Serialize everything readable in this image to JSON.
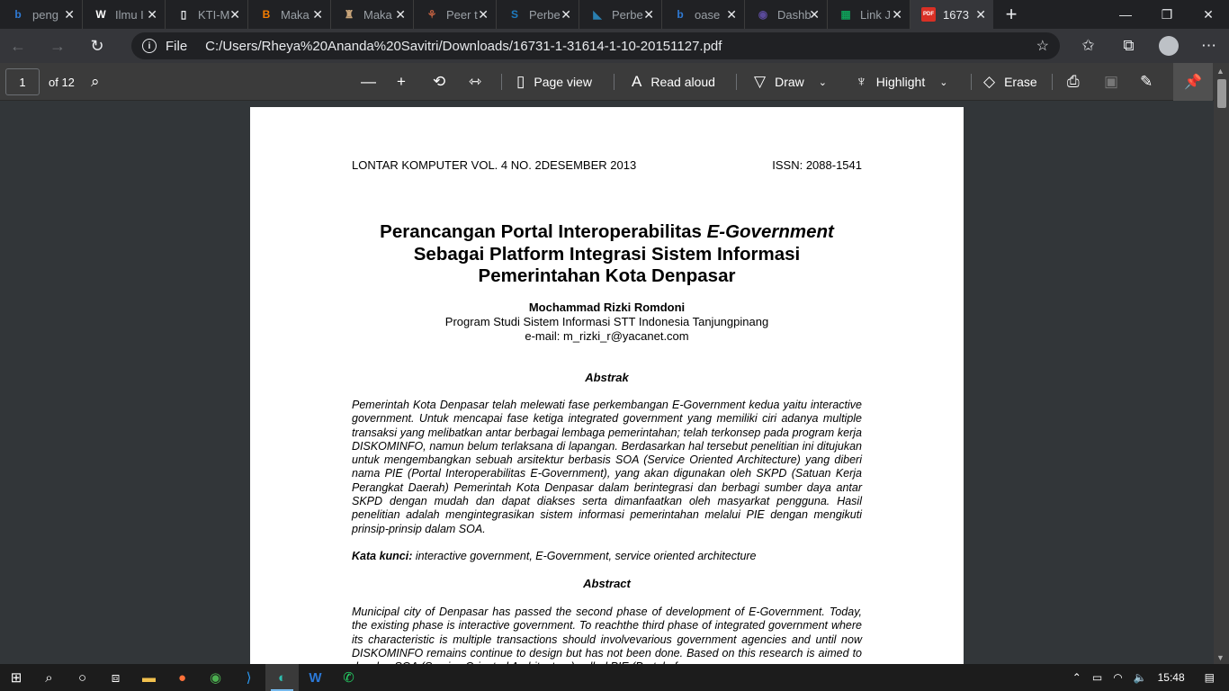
{
  "browser": {
    "tabs": [
      {
        "label": "peng",
        "icon": "bing-icon",
        "color": "#2f7bd6",
        "glyph": "b"
      },
      {
        "label": "Ilmu I",
        "icon": "wordpress-icon",
        "color": "#ffffff",
        "glyph": "W"
      },
      {
        "label": "KTI-M",
        "icon": "document-icon",
        "color": "#e8eaed",
        "glyph": "▯"
      },
      {
        "label": "Maka",
        "icon": "blogger-icon",
        "color": "#f57d00",
        "glyph": "B"
      },
      {
        "label": "Maka",
        "icon": "site-icon",
        "color": "#c9a57a",
        "glyph": "♜"
      },
      {
        "label": "Peer t",
        "icon": "site-icon",
        "color": "#c06040",
        "glyph": "⚘"
      },
      {
        "label": "Perbe",
        "icon": "scribd-icon",
        "color": "#1e7bc0",
        "glyph": "S"
      },
      {
        "label": "Perbe",
        "icon": "site-icon",
        "color": "#2a7fb0",
        "glyph": "◣"
      },
      {
        "label": "oase",
        "icon": "bing-icon",
        "color": "#2f7bd6",
        "glyph": "b"
      },
      {
        "label": "Dashb",
        "icon": "site-icon",
        "color": "#5a4a9a",
        "glyph": "◉"
      },
      {
        "label": "Link J",
        "icon": "sheets-icon",
        "color": "#0f9d58",
        "glyph": "▦"
      },
      {
        "label": "1673",
        "icon": "pdf-icon",
        "color": "#d93025",
        "glyph": "PDF"
      }
    ],
    "window_controls": {
      "minimize": "—",
      "restore": "❐",
      "close": "✕"
    },
    "address": {
      "scheme_label": "File",
      "url": "C:/Users/Rheya%20Ananda%20Savitri/Downloads/16731-1-31614-1-10-20151127.pdf"
    }
  },
  "pdf_toolbar": {
    "page_number": "1",
    "page_count": "of 12",
    "page_view": "Page view",
    "read_aloud": "Read aloud",
    "draw": "Draw",
    "highlight": "Highlight",
    "erase": "Erase"
  },
  "document": {
    "journal": "LONTAR KOMPUTER VOL. 4 NO. 2DESEMBER 2013",
    "issn": "ISSN: 2088-1541",
    "title_part1": "Perancangan Portal Interoperabilitas ",
    "title_italic": "E-Government",
    "title_line2": "Sebagai Platform Integrasi Sistem Informasi",
    "title_line3": "Pemerintahan Kota Denpasar",
    "author": "Mochammad Rizki Romdoni",
    "affiliation": "Program Studi Sistem Informasi STT Indonesia Tanjungpinang",
    "email": "e-mail: m_rizki_r@yacanet.com",
    "abstrak_heading": "Abstrak",
    "abstrak_text": "Pemerintah Kota Denpasar telah melewati fase perkembangan E-Government kedua yaitu interactive government. Untuk mencapai fase ketiga integrated government yang memiliki ciri adanya multiple transaksi yang melibatkan antar berbagai lembaga pemerintahan; telah terkonsep pada program kerja DISKOMINFO, namun belum terlaksana di lapangan. Berdasarkan hal tersebut penelitian ini ditujukan untuk mengembangkan sebuah arsitektur berbasis SOA (Service Oriented Architecture) yang diberi nama PIE (Portal Interoperabilitas E-Government), yang akan digunakan oleh SKPD (Satuan Kerja Perangkat Daerah) Pemerintah Kota Denpasar dalam berintegrasi dan berbagi sumber daya antar SKPD dengan mudah dan dapat diakses serta dimanfaatkan oleh masyarkat pengguna. Hasil penelitian adalah mengintegrasikan sistem informasi pemerintahan melalui PIE dengan mengikuti prinsip-prinsip dalam SOA.",
    "keywords_label": "Kata kunci:",
    "keywords": " interactive government, E-Government, service oriented architecture",
    "abstract_heading": "Abstract",
    "abstract_text": " Municipal city of Denpasar has passed the second phase of development of E-Government. Today, the existing phase is interactive government. To reachthe third phase of integrated government where its characteristic is multiple transactions should involvevarious government agencies and until now DISKOMINFO remains continue to design but has not been done. Based on this research is aimed to develop SOA (Service Oriented Architecture) called PIE (Portal of"
  },
  "taskbar": {
    "time": "15:48",
    "apps": [
      "windows-start-icon",
      "search-icon",
      "cortana-icon",
      "task-view-icon",
      "file-explorer-icon",
      "firefox-icon",
      "chrome-icon",
      "vscode-icon",
      "edge-icon",
      "word-icon",
      "whatsapp-icon"
    ]
  }
}
